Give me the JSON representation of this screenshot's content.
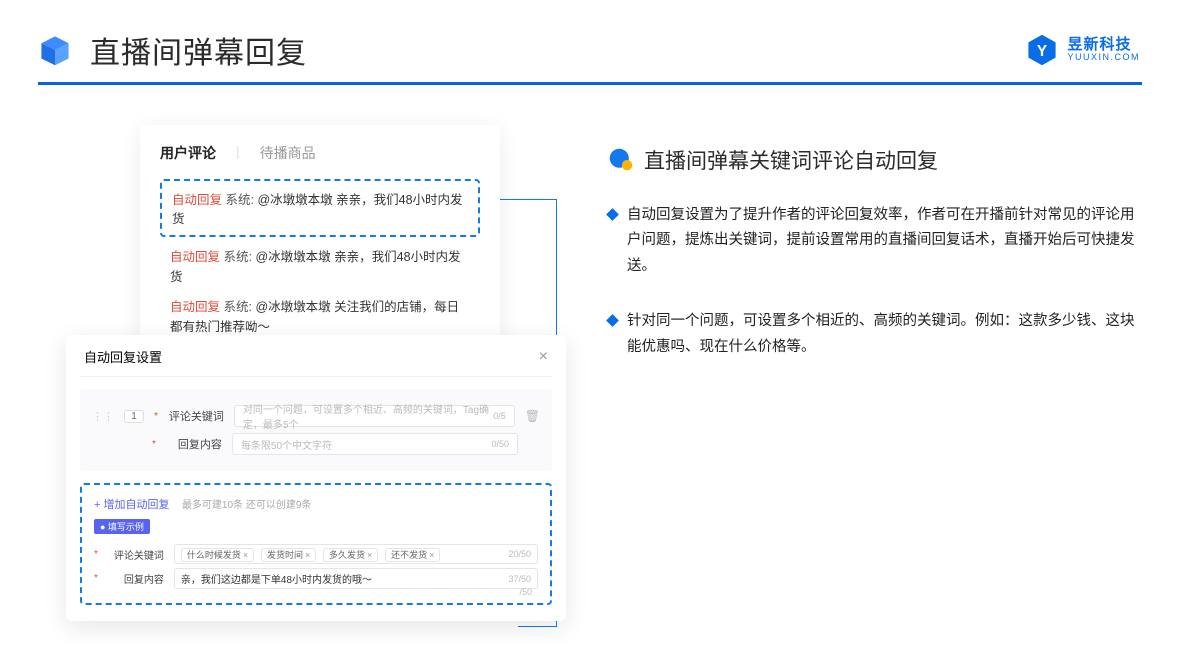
{
  "header": {
    "title": "直播间弹幕回复",
    "brand_cn": "昱新科技",
    "brand_en": "YUUXIN.COM"
  },
  "right": {
    "subtitle": "直播间弹幕关键词评论自动回复",
    "bullets": [
      "自动回复设置为了提升作者的评论回复效率，作者可在开播前针对常见的评论用户问题，提炼出关键词，提前设置常用的直播间回复话术，直播开始后可快捷发送。",
      "针对同一个问题，可设置多个相近的、高频的关键词。例如：这款多少钱、这块能优惠吗、现在什么价格等。"
    ]
  },
  "comment_card": {
    "tab_active": "用户评论",
    "tab_inactive": "待播商品",
    "highlight_tag": "自动回复",
    "highlight_sys": "系统:",
    "highlight_text": "@冰墩墩本墩 亲亲，我们48小时内发货",
    "lines": [
      {
        "tag": "自动回复",
        "sys": "系统:",
        "text": "@冰墩墩本墩 亲亲，我们48小时内发货"
      },
      {
        "tag": "自动回复",
        "sys": "系统:",
        "text": "@冰墩墩本墩 关注我们的店铺，每日都有热门推荐呦～"
      }
    ]
  },
  "settings_card": {
    "title": "自动回复设置",
    "index": "1",
    "row1_label": "评论关键词",
    "row1_placeholder": "对同一个问题，可设置多个相近、高频的关键词，Tag确定，最多5个",
    "row1_count": "0/5",
    "row2_label": "回复内容",
    "row2_placeholder": "每条限50个中文字符",
    "row2_count": "0/50",
    "add_link": "+ 增加自动回复",
    "add_hint": "最多可建10条 还可以创建9条",
    "example_badge": "● 填写示例",
    "ex_row1_label": "评论关键词",
    "ex_tags": [
      "什么时候发货",
      "发货时间",
      "多久发货",
      "还不发货"
    ],
    "ex_row1_count": "20/50",
    "ex_row2_label": "回复内容",
    "ex_row2_text": "亲，我们这边都是下单48小时内发货的哦～",
    "ex_row2_count": "37/50",
    "hidden_count": "/50"
  }
}
